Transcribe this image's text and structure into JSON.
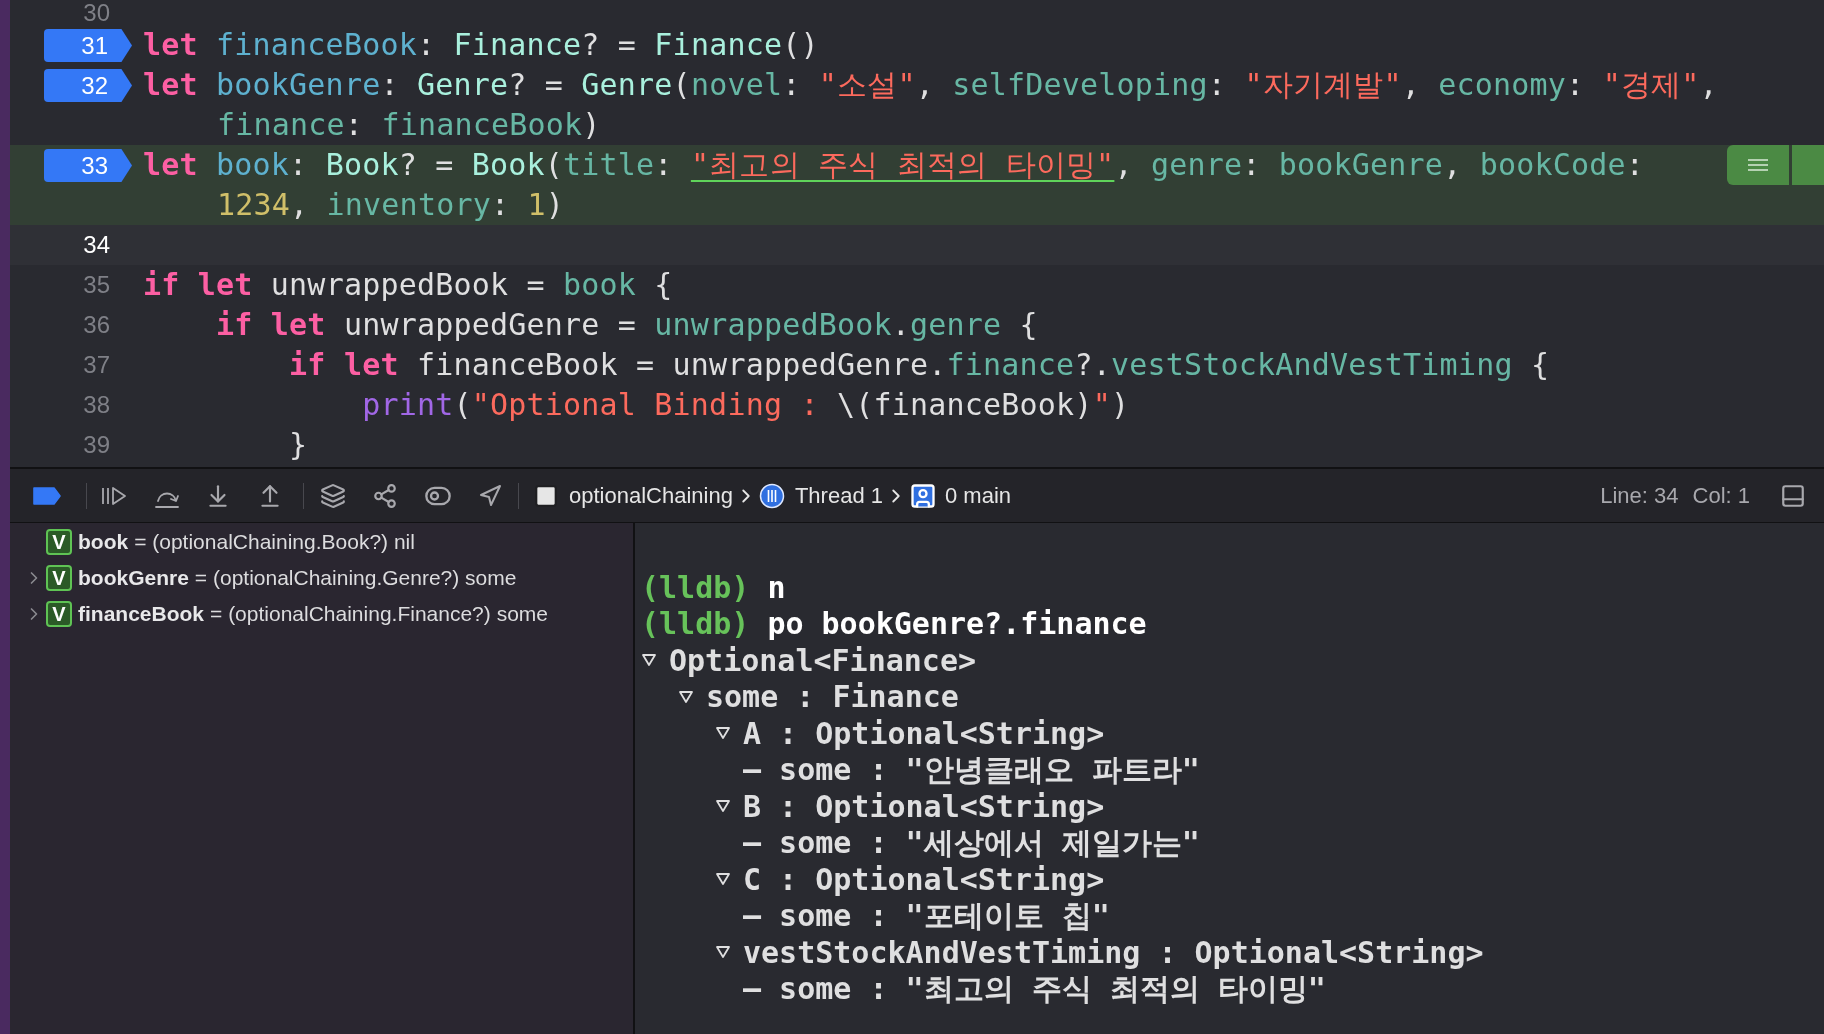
{
  "editor": {
    "lines": [
      {
        "number": "30",
        "breakpoint": false,
        "stopped": false,
        "cursor": false
      },
      {
        "number": "31",
        "breakpoint": true,
        "stopped": false,
        "cursor": false,
        "rows": [
          {
            "tokens": [
              {
                "kw": "let "
              },
              {
                "decl": "financeBook"
              },
              {
                "pl": ": "
              },
              {
                "type": "Finance"
              },
              {
                "pl": "? = "
              },
              {
                "type": "Finance"
              },
              {
                "pl": "()"
              }
            ]
          }
        ]
      },
      {
        "number": "32",
        "breakpoint": true,
        "stopped": false,
        "cursor": false,
        "rows": [
          {
            "tokens": [
              {
                "kw": "let "
              },
              {
                "decl": "bookGenre"
              },
              {
                "pl": ": "
              },
              {
                "type": "Genre"
              },
              {
                "pl": "? = "
              },
              {
                "type": "Genre"
              },
              {
                "pl": "("
              },
              {
                "param": "novel"
              },
              {
                "pl": ": "
              },
              {
                "str": "\"소설\""
              },
              {
                "pl": ", "
              },
              {
                "param": "selfDeveloping"
              },
              {
                "pl": ": "
              },
              {
                "str": "\"자기계발\""
              },
              {
                "pl": ", "
              },
              {
                "param": "economy"
              },
              {
                "pl": ": "
              },
              {
                "str": "\"경제\""
              },
              {
                "pl": ","
              }
            ]
          },
          {
            "tokens": [
              {
                "param": "finance"
              },
              {
                "pl": ": "
              },
              {
                "param": "financeBook"
              },
              {
                "pl": ")"
              }
            ]
          }
        ]
      },
      {
        "number": "33",
        "breakpoint": true,
        "stopped": true,
        "cursor": false,
        "rows": [
          {
            "tokens": [
              {
                "kw": "let "
              },
              {
                "decl": "book"
              },
              {
                "pl": ": "
              },
              {
                "type": "Book"
              },
              {
                "pl": "? = "
              },
              {
                "type": "Book"
              },
              {
                "pl": "("
              },
              {
                "param": "title"
              },
              {
                "pl": ": "
              },
              {
                "flagged": "\"최고의 주식 최적의 타이밍\""
              },
              {
                "pl": ", "
              },
              {
                "param": "genre"
              },
              {
                "pl": ": "
              },
              {
                "param": "bookGenre"
              },
              {
                "pl": ", "
              },
              {
                "param": "bookCode"
              },
              {
                "pl": ":"
              }
            ]
          },
          {
            "tokens": [
              {
                "num": "1234"
              },
              {
                "pl": ", "
              },
              {
                "param": "inventory"
              },
              {
                "pl": ": "
              },
              {
                "num": "1"
              },
              {
                "pl": ")"
              }
            ]
          }
        ]
      },
      {
        "number": "34",
        "breakpoint": false,
        "stopped": false,
        "cursor": true
      },
      {
        "number": "35",
        "breakpoint": false,
        "stopped": false,
        "cursor": false,
        "rows": [
          {
            "tokens": [
              {
                "kw": "if let "
              },
              {
                "pl": "unwrappedBook = "
              },
              {
                "param": "book"
              },
              {
                "pl": " {"
              }
            ]
          }
        ]
      },
      {
        "number": "36",
        "breakpoint": false,
        "stopped": false,
        "cursor": false,
        "rows": [
          {
            "tokens": [
              {
                "kw": "    if let "
              },
              {
                "pl": "unwrappedGenre = "
              },
              {
                "param": "unwrappedBook"
              },
              {
                "pl": "."
              },
              {
                "param": "genre"
              },
              {
                "pl": " {"
              }
            ]
          }
        ]
      },
      {
        "number": "37",
        "breakpoint": false,
        "stopped": false,
        "cursor": false,
        "rows": [
          {
            "tokens": [
              {
                "kw": "        if let "
              },
              {
                "pl": "financeBook = unwrappedGenre."
              },
              {
                "param": "finance"
              },
              {
                "pl": "?."
              },
              {
                "param": "vestStockAndVestTiming"
              },
              {
                "pl": " {"
              }
            ]
          }
        ]
      },
      {
        "number": "38",
        "breakpoint": false,
        "stopped": false,
        "cursor": false,
        "rows": [
          {
            "tokens": [
              {
                "func": "            print"
              },
              {
                "pl": "("
              },
              {
                "str": "\"Optional Binding : "
              },
              {
                "pl": "\\(financeBook)"
              },
              {
                "str": "\""
              },
              {
                "pl": ")"
              }
            ]
          }
        ]
      },
      {
        "number": "39",
        "breakpoint": false,
        "stopped": false,
        "cursor": false,
        "rows": [
          {
            "tokens": [
              {
                "pl": "        }"
              }
            ]
          }
        ]
      }
    ]
  },
  "debug_bar": {
    "breakpoints_active": true,
    "breadcrumbs": [
      {
        "kind": "process",
        "label": "optionalChaining"
      },
      {
        "kind": "thread",
        "label": "Thread 1"
      },
      {
        "kind": "frame",
        "label": "0 main"
      }
    ],
    "line": "Line: 34",
    "column": "Col: 1"
  },
  "variables": [
    {
      "badge": "V",
      "name": "book",
      "description": "= (optionalChaining.Book?) nil",
      "expandable": false
    },
    {
      "badge": "V",
      "name": "bookGenre",
      "description": "= (optionalChaining.Genre?) some",
      "expandable": true
    },
    {
      "badge": "V",
      "name": "financeBook",
      "description": "= (optionalChaining.Finance?) some",
      "expandable": true
    }
  ],
  "console": {
    "commands": [
      {
        "prompt": "(lldb)",
        "command": "n"
      },
      {
        "prompt": "(lldb)",
        "command": "po bookGenre?.finance"
      }
    ],
    "output": [
      {
        "label": "Optional<Finance>",
        "expanded": true,
        "children": [
          {
            "label": "some : Finance",
            "expanded": true,
            "children": [
              {
                "label": "A : Optional<String>",
                "expanded": true,
                "children": [
                  {
                    "bullet": "–",
                    "label": "some : \"안녕클래오 파트라\""
                  }
                ]
              },
              {
                "label": "B : Optional<String>",
                "expanded": true,
                "children": [
                  {
                    "bullet": "–",
                    "label": "some : \"세상에서 제일가는\""
                  }
                ]
              },
              {
                "label": "C : Optional<String>",
                "expanded": true,
                "children": [
                  {
                    "bullet": "–",
                    "label": "some : \"포테이토 칩\""
                  }
                ]
              },
              {
                "label": "vestStockAndVestTiming : Optional<String>",
                "expanded": true,
                "children": [
                  {
                    "bullet": "–",
                    "label": "some : \"최고의 주식 최적의 타이밍\""
                  }
                ]
              }
            ]
          }
        ]
      }
    ]
  }
}
